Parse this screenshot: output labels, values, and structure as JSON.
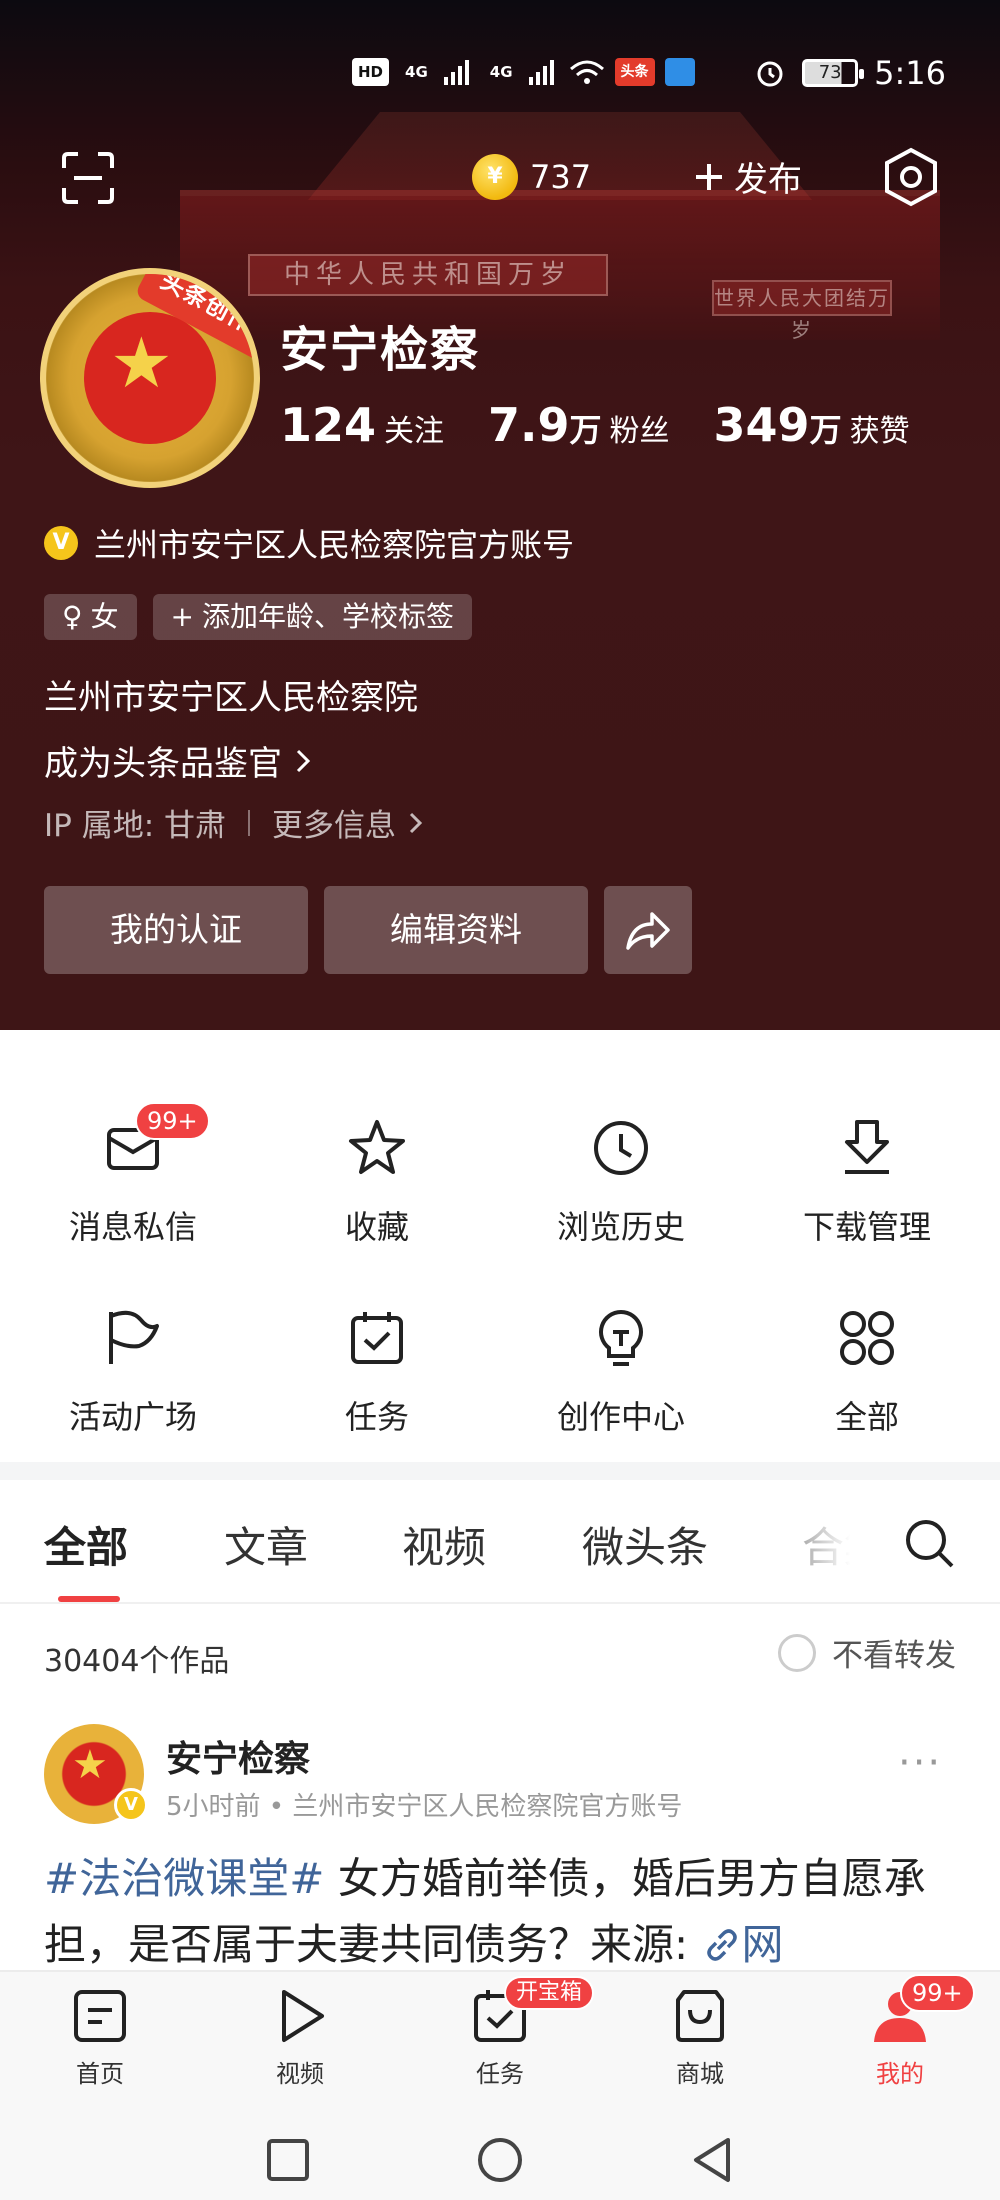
{
  "status_bar": {
    "hd_label": "HD",
    "network1": "4G",
    "network2": "4G",
    "app_badge": "头条",
    "battery": "73",
    "time": "5:16"
  },
  "header": {
    "coins": "737",
    "publish_label": "发布",
    "avatar_ribbon": "头条创作者",
    "name": "安宁检察",
    "stats": [
      {
        "num": "124",
        "unit": "",
        "label": "关注"
      },
      {
        "num": "7.9",
        "unit": "万",
        "label": "粉丝"
      },
      {
        "num": "349",
        "unit": "万",
        "label": "获赞"
      }
    ],
    "verify_badge": "V",
    "verify_text": "兰州市安宁区人民检察院官方账号",
    "tags": [
      {
        "icon": "♀",
        "text": "女"
      },
      {
        "icon": "+",
        "text": "添加年龄、学校标签"
      }
    ],
    "org": "兰州市安宁区人民检察院",
    "critic_link": "成为头条品鉴官",
    "ip_text": "IP 属地: 甘肃",
    "more_info": "更多信息",
    "buttons": {
      "cert": "我的认证",
      "edit": "编辑资料"
    },
    "bg_banner1": "中华人民共和国万岁",
    "bg_banner2": "世界人民大团结万岁"
  },
  "grid": {
    "items": [
      {
        "label": "消息私信",
        "icon": "mail-icon",
        "badge": "99+"
      },
      {
        "label": "收藏",
        "icon": "star-icon"
      },
      {
        "label": "浏览历史",
        "icon": "clock-icon"
      },
      {
        "label": "下载管理",
        "icon": "download-icon"
      },
      {
        "label": "活动广场",
        "icon": "flag-icon"
      },
      {
        "label": "任务",
        "icon": "calendar-check-icon"
      },
      {
        "label": "创作中心",
        "icon": "bulb-icon"
      },
      {
        "label": "全部",
        "icon": "grid-icon"
      }
    ]
  },
  "tabs": {
    "items": [
      "全部",
      "文章",
      "视频",
      "微头条",
      "合集"
    ],
    "active": "全部"
  },
  "works": {
    "count_text": "30404个作品",
    "no_forward": "不看转发"
  },
  "post": {
    "author": "安宁检察",
    "meta": "5小时前 • 兰州市安宁区人民检察院官方账号",
    "more": "···",
    "topic": "#法治微课堂#",
    "text": " 女方婚前举债，婚后男方自愿承担，是否属于夫妻共同债务？来源: ",
    "link": "网"
  },
  "bottom_nav": {
    "items": [
      {
        "label": "首页",
        "icon": "home-icon"
      },
      {
        "label": "视频",
        "icon": "play-icon"
      },
      {
        "label": "任务",
        "icon": "task-icon",
        "badge": "开宝箱"
      },
      {
        "label": "商城",
        "icon": "bag-icon"
      },
      {
        "label": "我的",
        "icon": "profile-icon",
        "badge": "99+"
      }
    ],
    "active": "我的"
  },
  "colors": {
    "accent": "#f04142",
    "header_bg": "#3e1516",
    "link": "#406599"
  }
}
